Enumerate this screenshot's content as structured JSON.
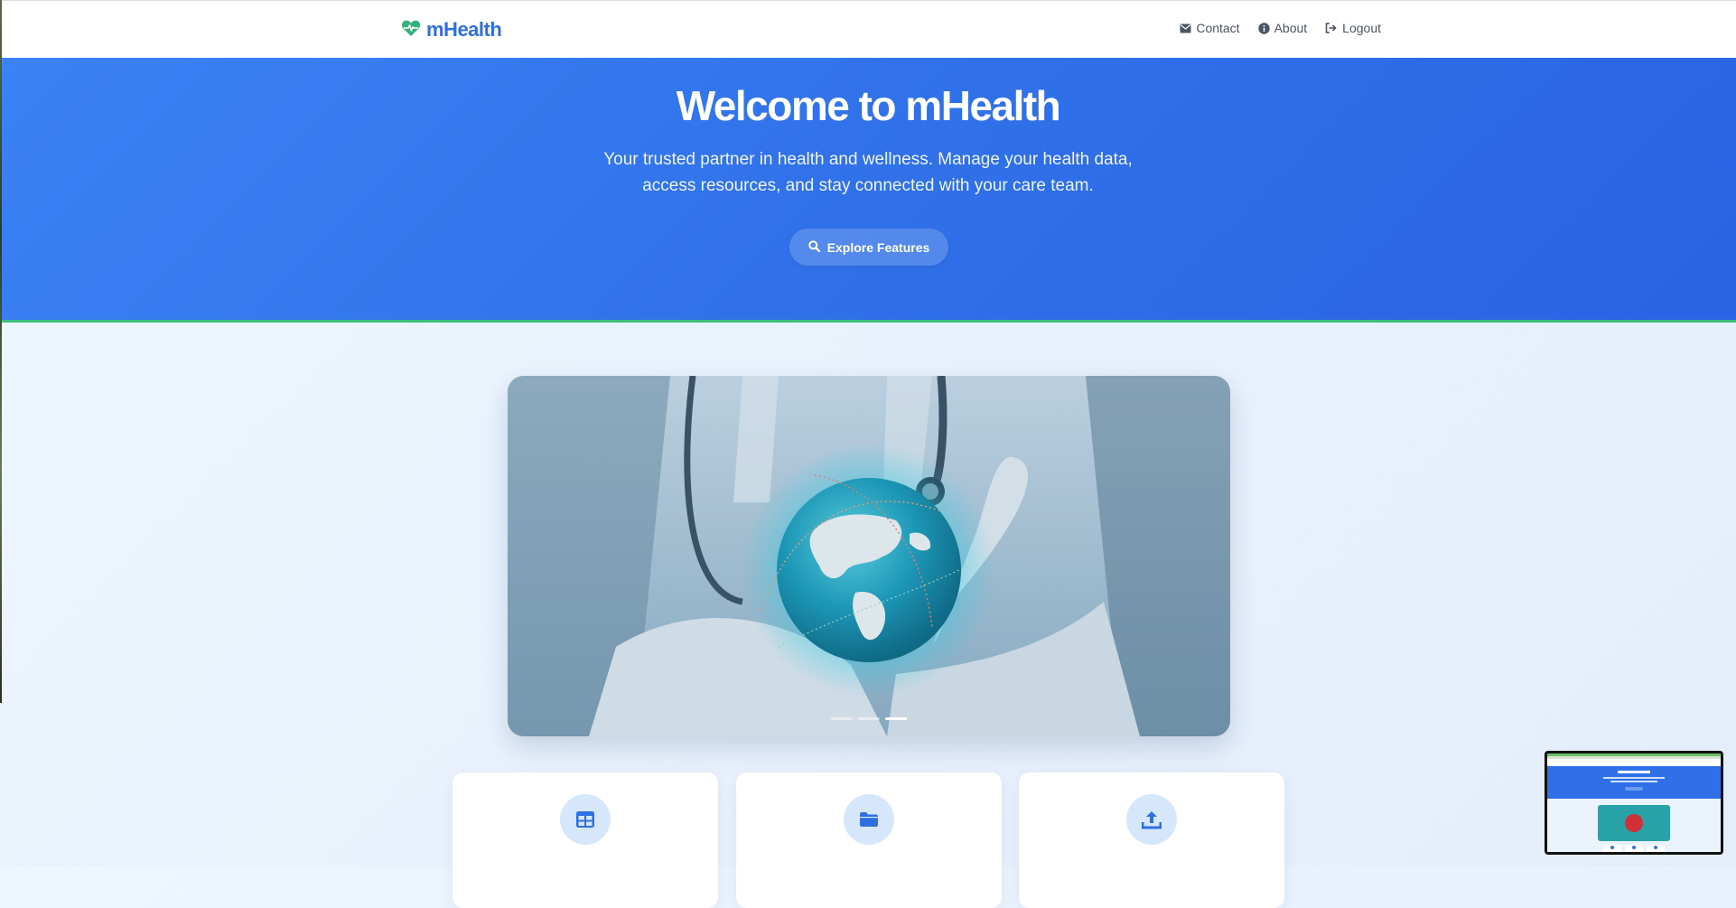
{
  "brand": {
    "name": "mHealth",
    "icon": "heart-pulse-icon",
    "color": "#2f6fe4",
    "icon_color": "#34b27b"
  },
  "nav": [
    {
      "label": "Contact",
      "icon": "envelope-icon"
    },
    {
      "label": "About",
      "icon": "info-circle-icon"
    },
    {
      "label": "Logout",
      "icon": "sign-out-icon"
    }
  ],
  "hero": {
    "title": "Welcome to mHealth",
    "subtitle": "Your trusted partner in health and wellness. Manage your health data, access resources, and stay connected with your care team.",
    "cta_label": "Explore Features",
    "cta_icon": "search-icon",
    "background": "#2f6fe8",
    "accent_border": "#3bbf7a"
  },
  "carousel": {
    "image": "doctor-holding-globe-image",
    "slide_count": 3,
    "active_slide": 3
  },
  "cards": [
    {
      "icon": "table-icon"
    },
    {
      "icon": "folder-icon"
    },
    {
      "icon": "upload-icon"
    }
  ],
  "thumbnail": {
    "label": "Welcome to mHealth"
  }
}
